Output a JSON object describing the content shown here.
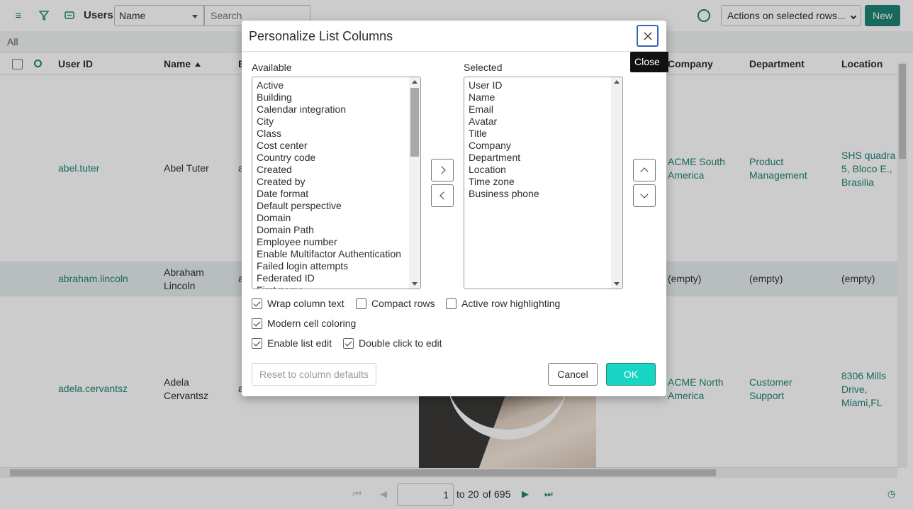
{
  "topbar": {
    "title": "Users",
    "search_field_select": "Name",
    "search_placeholder": "Search",
    "actions_select": "Actions on selected rows...",
    "new_label": "New"
  },
  "filter": {
    "label": "All"
  },
  "columns": [
    "User ID",
    "Name",
    "E",
    "Company",
    "Department",
    "Location"
  ],
  "rows": [
    {
      "user_id": "abel.tuter",
      "name": "Abel Tuter",
      "email": "a",
      "company": "ACME South America",
      "department": "Product Management",
      "location": "SHS quadra 5, Bloco E., Brasilia"
    },
    {
      "user_id": "abraham.lincoln",
      "name": "Abraham Lincoln",
      "email": "a",
      "company": "(empty)",
      "department": "(empty)",
      "location": "(empty)"
    },
    {
      "user_id": "adela.cervantsz",
      "name": "Adela Cervantsz",
      "email": "a",
      "company": "ACME North America",
      "department": "Customer Support",
      "location": "8306 Mills Drive, Miami,FL"
    }
  ],
  "pagination": {
    "current": "1",
    "to_label": "to",
    "end": "20",
    "of_label": "of",
    "total": "695"
  },
  "dialog": {
    "title": "Personalize List Columns",
    "close_tooltip": "Close",
    "available_label": "Available",
    "selected_label": "Selected",
    "available": [
      "Active",
      "Building",
      "Calendar integration",
      "City",
      "Class",
      "Cost center",
      "Country code",
      "Created",
      "Created by",
      "Date format",
      "Default perspective",
      "Domain",
      "Domain Path",
      "Employee number",
      "Enable Multifactor Authentication",
      "Failed login attempts",
      "Federated ID",
      "First name"
    ],
    "selected": [
      "User ID",
      "Name",
      "Email",
      "Avatar",
      "Title",
      "Company",
      "Department",
      "Location",
      "Time zone",
      "Business phone"
    ],
    "options": {
      "wrap_column_text": {
        "label": "Wrap column text",
        "checked": true
      },
      "compact_rows": {
        "label": "Compact rows",
        "checked": false
      },
      "active_row_highlighting": {
        "label": "Active row highlighting",
        "checked": false
      },
      "modern_cell_coloring": {
        "label": "Modern cell coloring",
        "checked": true
      },
      "enable_list_edit": {
        "label": "Enable list edit",
        "checked": true
      },
      "double_click_to_edit": {
        "label": "Double click to edit",
        "checked": true
      }
    },
    "reset_label": "Reset to column defaults",
    "cancel_label": "Cancel",
    "ok_label": "OK"
  },
  "colors": {
    "accent": "#1f8476",
    "ok_button": "#19d5c4",
    "focus_ring": "#3a66b8"
  }
}
